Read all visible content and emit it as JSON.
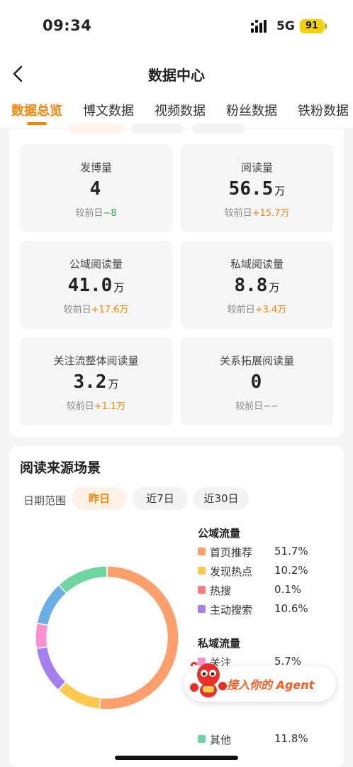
{
  "status_bar": {
    "time": "09:34",
    "network": "5G",
    "battery": "91"
  },
  "header": {
    "title": "数据中心"
  },
  "tabs": [
    {
      "label": "数据总览",
      "active": true
    },
    {
      "label": "博文数据",
      "active": false
    },
    {
      "label": "视频数据",
      "active": false
    },
    {
      "label": "粉丝数据",
      "active": false
    },
    {
      "label": "铁粉数据",
      "active": false
    }
  ],
  "stats": [
    {
      "label": "发博量",
      "value": "4",
      "unit": "",
      "delta_prefix": "较前日",
      "delta": "−8",
      "trend": "down"
    },
    {
      "label": "阅读量",
      "value": "56.5",
      "unit": "万",
      "delta_prefix": "较前日",
      "delta": "+15.7万",
      "trend": "up"
    },
    {
      "label": "公域阅读量",
      "value": "41.0",
      "unit": "万",
      "delta_prefix": "较前日",
      "delta": "+17.6万",
      "trend": "up"
    },
    {
      "label": "私域阅读量",
      "value": "8.8",
      "unit": "万",
      "delta_prefix": "较前日",
      "delta": "+3.4万",
      "trend": "up"
    },
    {
      "label": "关注流整体阅读量",
      "value": "3.2",
      "unit": "万",
      "delta_prefix": "较前日",
      "delta": "+1.1万",
      "trend": "up"
    },
    {
      "label": "关系拓展阅读量",
      "value": "0",
      "unit": "",
      "delta_prefix": "较前日",
      "delta": "−−",
      "trend": "flat"
    }
  ],
  "source_section": {
    "title": "阅读来源场景",
    "range_label": "日期范围",
    "ranges": [
      {
        "label": "昨日",
        "active": true
      },
      {
        "label": "近7日",
        "active": false
      },
      {
        "label": "近30日",
        "active": false
      }
    ]
  },
  "legend": {
    "public_group": "公域流量",
    "public_items": [
      {
        "name": "首页推荐",
        "pct": "51.7%",
        "color": "#ff9f6b"
      },
      {
        "name": "发现热点",
        "pct": "10.2%",
        "color": "#ffc94d"
      },
      {
        "name": "热搜",
        "pct": "0.1%",
        "color": "#ff7a7a"
      },
      {
        "name": "主动搜索",
        "pct": "10.6%",
        "color": "#a57ff0"
      }
    ],
    "private_group": "私域流量",
    "private_items": [
      {
        "name": "关注",
        "pct": "5.7%",
        "color": "#ff8fd0"
      }
    ],
    "other": {
      "name": "其他",
      "pct": "11.8%",
      "color": "#6ed4a0"
    }
  },
  "chart_data": {
    "type": "pie",
    "donut": true,
    "slices": [
      {
        "name": "首页推荐",
        "value": 51.7,
        "color": "#ff9f6b"
      },
      {
        "name": "发现热点",
        "value": 10.2,
        "color": "#ffc94d"
      },
      {
        "name": "热搜",
        "value": 0.1,
        "color": "#ff7a7a"
      },
      {
        "name": "主动搜索",
        "value": 10.6,
        "color": "#a57ff0"
      },
      {
        "name": "关注",
        "value": 5.7,
        "color": "#ff8fd0"
      },
      {
        "name": "(未显示)",
        "value": 9.9,
        "color": "#6aaee8"
      },
      {
        "name": "其他",
        "value": 11.8,
        "color": "#6ed4a0"
      }
    ]
  },
  "agent_button": {
    "label": "接入你的 Agent"
  }
}
